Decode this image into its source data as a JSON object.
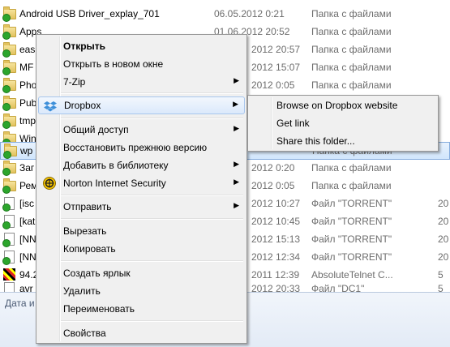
{
  "files": [
    {
      "name": "Android USB Driver_explay_701",
      "date": "06.05.2012 0:21",
      "type": "Папка с файлами",
      "size": "",
      "kind": "folder"
    },
    {
      "name": "Apps",
      "date": "01.06.2012 20:52",
      "type": "Папка с файлами",
      "size": "",
      "kind": "folder"
    },
    {
      "name": "eas",
      "date": "2012 20:57",
      "type": "Папка с файлами",
      "size": "",
      "kind": "folder"
    },
    {
      "name": "MF",
      "date": "2012 15:07",
      "type": "Папка с файлами",
      "size": "",
      "kind": "folder"
    },
    {
      "name": "Pho",
      "date": "2012 0:05",
      "type": "Папка с файлами",
      "size": "",
      "kind": "folder"
    },
    {
      "name": "Pub",
      "date": "",
      "type": "",
      "size": "",
      "kind": "folder"
    },
    {
      "name": "tmp",
      "date": "",
      "type": "",
      "size": "",
      "kind": "folder"
    },
    {
      "name": "Win",
      "date": "",
      "type": "",
      "size": "",
      "kind": "folder"
    },
    {
      "name": "wp",
      "date": "",
      "type": "Папка с файлами",
      "size": "",
      "kind": "folder"
    },
    {
      "name": "Заг",
      "date": "2012 0:20",
      "type": "Папка с файлами",
      "size": "",
      "kind": "folder"
    },
    {
      "name": "Рем",
      "date": "2012 0:05",
      "type": "Папка с файлами",
      "size": "",
      "kind": "folder"
    },
    {
      "name": "[isc",
      "date": "2012 10:27",
      "type": "Файл \"TORRENT\"",
      "size": "20",
      "kind": "doc"
    },
    {
      "name": "[kat",
      "date": "2012 10:45",
      "type": "Файл \"TORRENT\"",
      "size": "20",
      "kind": "doc"
    },
    {
      "name": "[NN",
      "date": "2012 15:13",
      "type": "Файл \"TORRENT\"",
      "size": "20",
      "kind": "doc"
    },
    {
      "name": "[NN",
      "date": "2012 12:34",
      "type": "Файл \"TORRENT\"",
      "size": "20",
      "kind": "doc"
    },
    {
      "name": "94.2",
      "date": "2011 12:39",
      "type": "AbsoluteTelnet C...",
      "size": "5",
      "kind": "telnet"
    },
    {
      "name": "avr",
      "date": "2012 20:33",
      "type": "Файл \"DC1\"",
      "size": "5",
      "kind": "doc"
    }
  ],
  "statusbar": {
    "label": "Дата и"
  },
  "context_menu": {
    "items": [
      {
        "label": "Открыть",
        "bold": true,
        "arrow": "",
        "icon": ""
      },
      {
        "label": "Открыть в новом окне",
        "bold": false,
        "arrow": "",
        "icon": ""
      },
      {
        "label": "7-Zip",
        "bold": false,
        "arrow": "▶",
        "icon": ""
      },
      {
        "label": "Dropbox",
        "bold": false,
        "arrow": "▶",
        "icon": "dropbox-icon",
        "highlighted": true
      },
      {
        "label": "Общий доступ",
        "bold": false,
        "arrow": "▶",
        "icon": ""
      },
      {
        "label": "Восстановить прежнюю версию",
        "bold": false,
        "arrow": "",
        "icon": ""
      },
      {
        "label": "Добавить в библиотеку",
        "bold": false,
        "arrow": "▶",
        "icon": ""
      },
      {
        "label": "Norton Internet Security",
        "bold": false,
        "arrow": "▶",
        "icon": "norton-icon"
      },
      {
        "label": "Отправить",
        "bold": false,
        "arrow": "▶",
        "icon": ""
      },
      {
        "label": "Вырезать",
        "bold": false,
        "arrow": "",
        "icon": ""
      },
      {
        "label": "Копировать",
        "bold": false,
        "arrow": "",
        "icon": ""
      },
      {
        "label": "Создать ярлык",
        "bold": false,
        "arrow": "",
        "icon": ""
      },
      {
        "label": "Удалить",
        "bold": false,
        "arrow": "",
        "icon": ""
      },
      {
        "label": "Переименовать",
        "bold": false,
        "arrow": "",
        "icon": ""
      },
      {
        "label": "Свойства",
        "bold": false,
        "arrow": "",
        "icon": ""
      }
    ]
  },
  "dropbox_submenu": {
    "items": [
      {
        "label": "Browse on Dropbox website"
      },
      {
        "label": "Get link"
      },
      {
        "label": "Share this folder..."
      }
    ]
  },
  "colors": {
    "dropbox": "#3d8fd9",
    "norton_yellow": "#f5c400",
    "selection_border": "#84acdd"
  }
}
